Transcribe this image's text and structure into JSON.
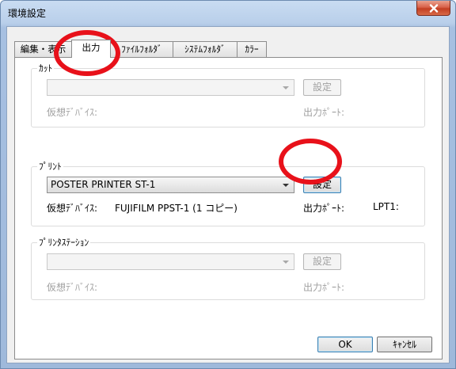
{
  "window": {
    "title": "環境設定"
  },
  "tabs": [
    {
      "label": "編集・表示"
    },
    {
      "label": "出力"
    },
    {
      "label": "ﾌｧｲﾙﾌｫﾙﾀﾞ"
    },
    {
      "label": "ｼｽﾃﾑﾌｫﾙﾀﾞ"
    },
    {
      "label": "ｶﾗｰ"
    }
  ],
  "active_tab": "出力",
  "cut": {
    "label": "ｶｯﾄ",
    "device_value": "",
    "settings_label": "設定",
    "virtual_device_label": "仮想ﾃﾞﾊﾞｲｽ:",
    "virtual_device_value": "",
    "port_label": "出力ﾎﾟｰﾄ:",
    "port_value": ""
  },
  "print": {
    "label": "ﾌﾟﾘﾝﾄ",
    "device_value": "POSTER PRINTER ST-1",
    "settings_label": "設定",
    "virtual_device_label": "仮想ﾃﾞﾊﾞｲｽ:",
    "virtual_device_value": "FUJIFILM PPST-1 (1 コピー)",
    "port_label": "出力ﾎﾟｰﾄ:",
    "port_value": "LPT1:"
  },
  "print_station": {
    "label": "ﾌﾟﾘﾝﾀｽﾃｰｼｮﾝ",
    "device_value": "",
    "settings_label": "設定",
    "virtual_device_label": "仮想ﾃﾞﾊﾞｲｽ:",
    "virtual_device_value": "",
    "port_label": "出力ﾎﾟｰﾄ:",
    "port_value": ""
  },
  "footer": {
    "ok_label": "OK",
    "cancel_label": "ｷｬﾝｾﾙ"
  },
  "annotation_color": "#e8111a"
}
